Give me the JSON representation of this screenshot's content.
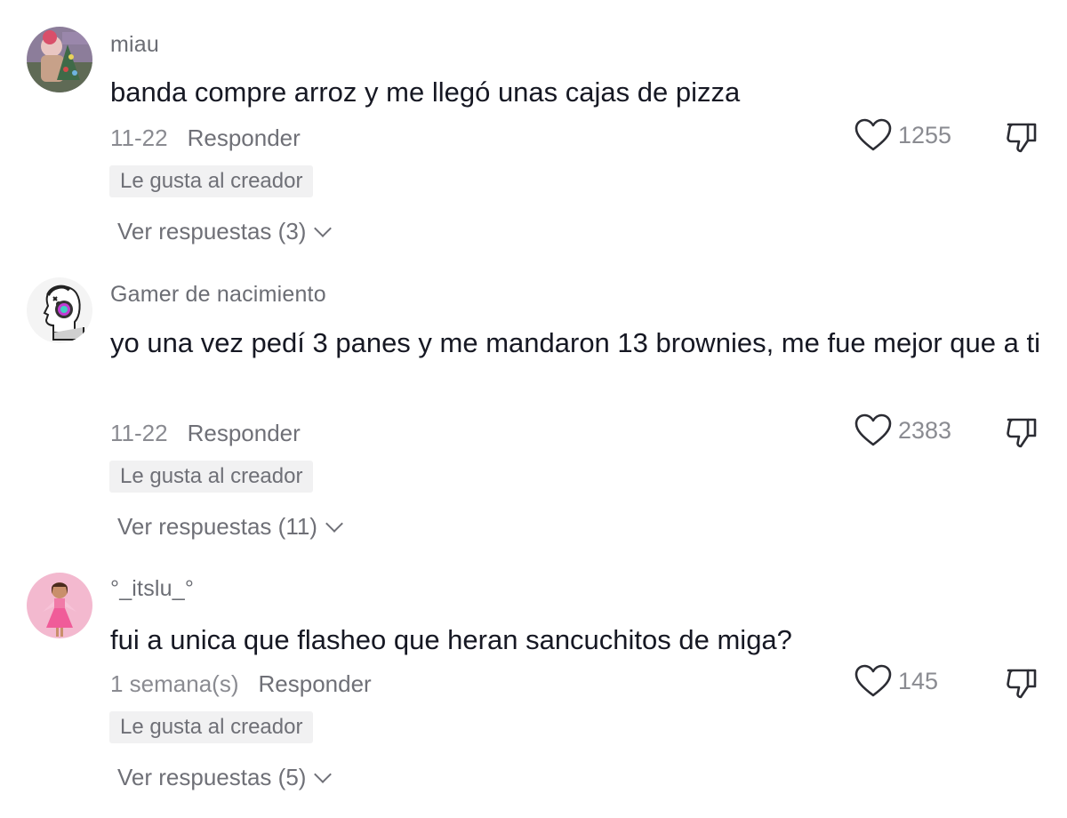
{
  "comments": [
    {
      "username": "miau",
      "text": "banda compre arroz y me llegó unas cajas de pizza",
      "date": "11-22",
      "reply_label": "Responder",
      "badge": "Le gusta al creador",
      "likes": "1255",
      "view_replies": "Ver respuestas (3)",
      "avatar_icon": "avatar-photo-christmas"
    },
    {
      "username": "Gamer de nacimiento",
      "text": "yo una vez pedí 3 panes y me mandaron 13 brownies, me fue mejor que a ti",
      "date": "11-22",
      "reply_label": "Responder",
      "badge": "Le gusta al creador",
      "likes": "2383",
      "view_replies": "Ver respuestas (11)",
      "avatar_icon": "avatar-gamer-headset"
    },
    {
      "username": "°_itslu_°",
      "text": "fui a unica que flasheo que heran sancuchitos de miga?",
      "date": "1 semana(s)",
      "reply_label": "Responder",
      "badge": "Le gusta al creador",
      "likes": "145",
      "view_replies": "Ver respuestas (5)",
      "avatar_icon": "avatar-girl-pink-dress"
    }
  ],
  "colors": {
    "text_primary": "#161823",
    "text_secondary": "#8a8b91",
    "badge_bg": "#f1f1f2"
  }
}
